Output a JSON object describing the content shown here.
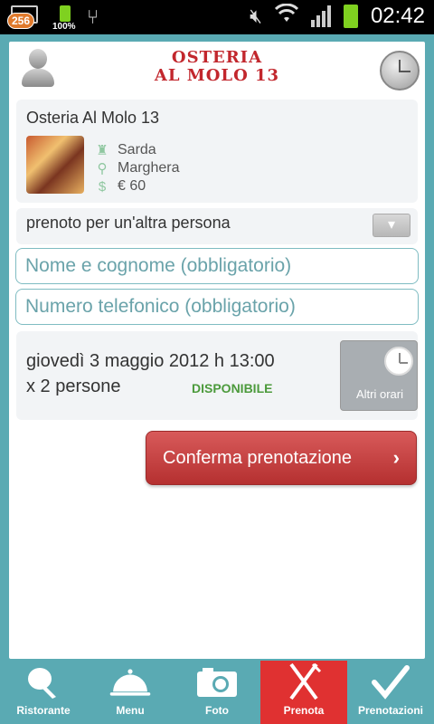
{
  "status_bar": {
    "badge": "256",
    "battery_pct": "100%",
    "time": "02:42"
  },
  "header": {
    "logo_line1": "OSTERIA",
    "logo_line2": "AL MOLO 13"
  },
  "restaurant": {
    "name": "Osteria Al Molo 13",
    "cuisine": "Sarda",
    "location": "Marghera",
    "price": "€ 60"
  },
  "other_person": {
    "label": "prenoto per un'altra persona"
  },
  "form": {
    "name_placeholder": "Nome e cognome (obbligatorio)",
    "phone_placeholder": "Numero telefonico (obbligatorio)"
  },
  "slot": {
    "date_time": "giovedì 3 maggio 2012 h 13:00",
    "persons": "x 2 persone",
    "availability": "DISPONIBILE",
    "other_times_label": "Altri orari"
  },
  "confirm_label": "Conferma prenotazione",
  "tabs": [
    {
      "label": "Ristorante",
      "icon": "pencil-icon"
    },
    {
      "label": "Menu",
      "icon": "cloche-icon"
    },
    {
      "label": "Foto",
      "icon": "camera-icon"
    },
    {
      "label": "Prenota",
      "icon": "fork-knife-icon",
      "active": true
    },
    {
      "label": "Prenotazioni",
      "icon": "checkmark-icon"
    }
  ],
  "colors": {
    "background": "#5aaab3",
    "brand_red": "#c2272d",
    "active_tab": "#e03131",
    "available_green": "#4c9a3c"
  }
}
